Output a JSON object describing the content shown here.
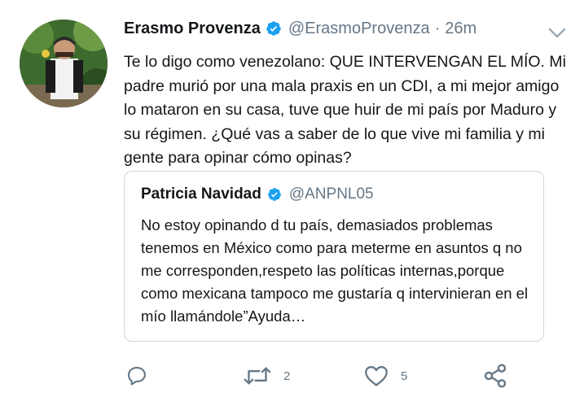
{
  "tweet": {
    "author_name": "Erasmo Provenza",
    "author_handle": "@ErasmoProvenza",
    "separator": "·",
    "timestamp": "26m",
    "text": "Te lo digo como venezolano: QUE INTERVENGAN EL MÍO. Mi padre murió por una mala praxis en un CDI, a mi mejor amigo lo mataron en su casa, tuve que huir de mi país por Maduro y su régimen. ¿Qué vas a saber de lo que vive mi familia y mi gente para opinar cómo opinas?",
    "verified": true,
    "avatar_icon": "profile-photo"
  },
  "quoted_tweet": {
    "author_name": "Patricia Navidad",
    "author_handle": "@ANPNL05",
    "verified": true,
    "text": "No estoy opinando d tu país, demasiados problemas tenemos en México como para meterme en asuntos q no me corresponden,respeto las políticas internas,porque como mexicana tampoco me gustaría q intervinieran en el mío llamándole”Ayuda…"
  },
  "actions": {
    "reply_icon": "reply-icon",
    "retweet_icon": "retweet-icon",
    "retweet_count": "2",
    "like_icon": "heart-icon",
    "like_count": "5",
    "share_icon": "share-icon"
  },
  "colors": {
    "verified_blue": "#1da1f2",
    "icon_gray": "#657786",
    "border": "#ccd6dd"
  }
}
